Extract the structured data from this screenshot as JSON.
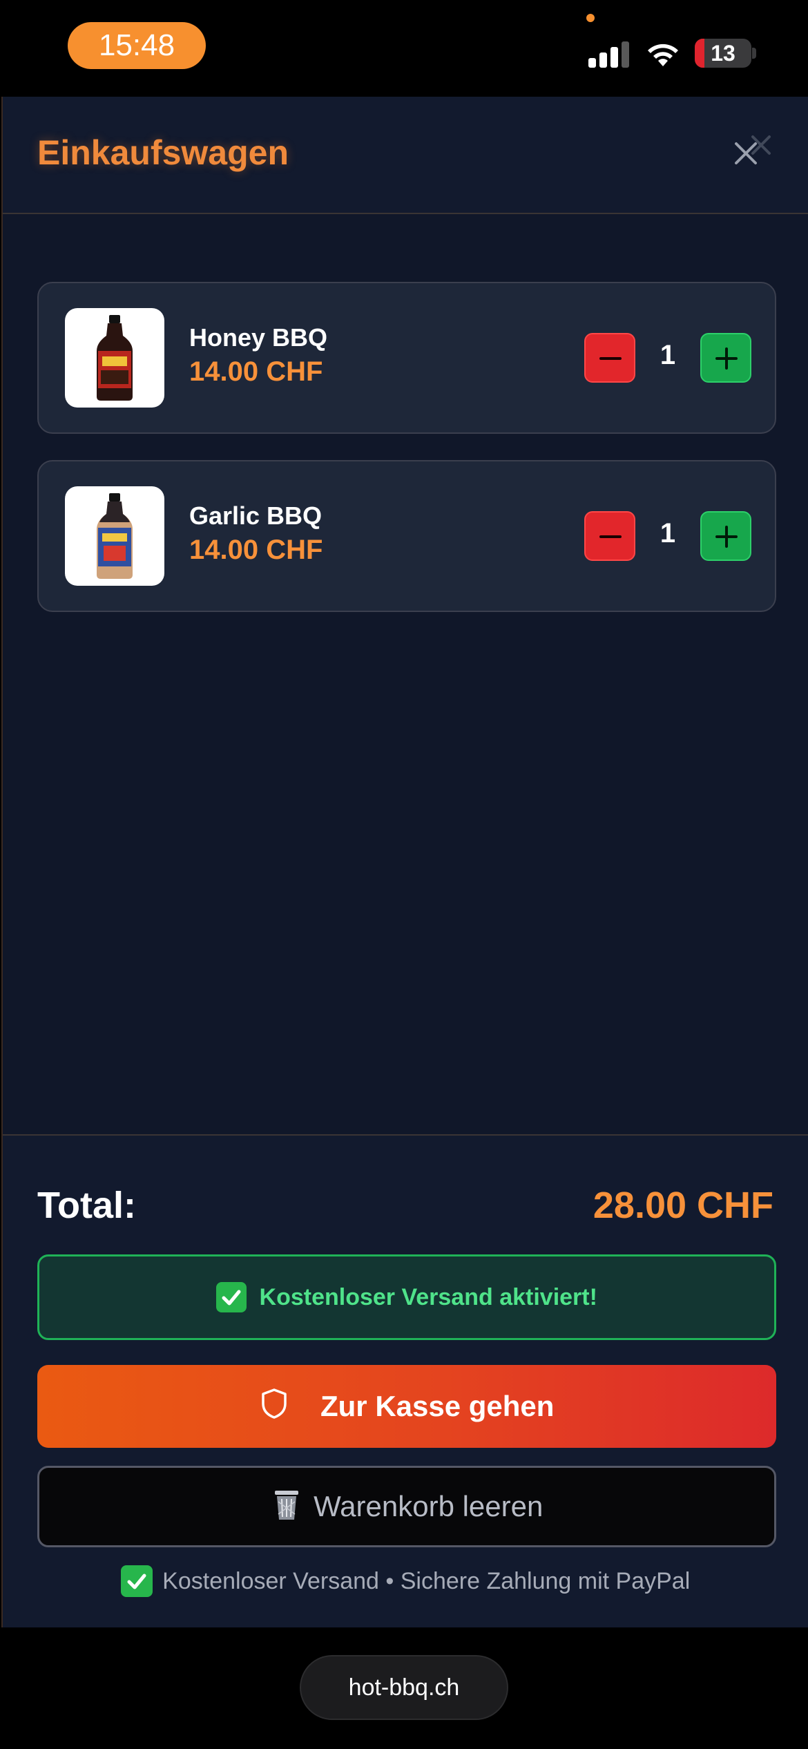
{
  "status_bar": {
    "time": "15:48",
    "battery_level": "13",
    "accent_color": "#f7902f"
  },
  "drawer": {
    "title": "Einkaufswagen",
    "close_icon": "close-icon"
  },
  "cart": {
    "items": [
      {
        "name": "Honey BBQ",
        "price": "14.00 CHF",
        "quantity": "1",
        "image_icon": "sauce-bottle-red-label"
      },
      {
        "name": "Garlic BBQ",
        "price": "14.00 CHF",
        "quantity": "1",
        "image_icon": "sauce-bottle-blue-label"
      }
    ]
  },
  "footer": {
    "total_label": "Total:",
    "total_value": "28.00 CHF",
    "shipping_banner": "Kostenloser Versand aktiviert!",
    "checkout_label": "Zur Kasse gehen",
    "clear_label": "Warenkorb leeren",
    "note": "Kostenloser Versand • Sichere Zahlung mit PayPal"
  },
  "browser": {
    "url": "hot-bbq.ch"
  },
  "colors": {
    "background": "#101729",
    "price": "#f7913a",
    "minus_button": "#e2262b",
    "plus_button": "#17a74c",
    "checkout_gradient_start": "#ea5a12",
    "checkout_gradient_end": "#dd2a2b",
    "success_green": "#4fe38a"
  }
}
